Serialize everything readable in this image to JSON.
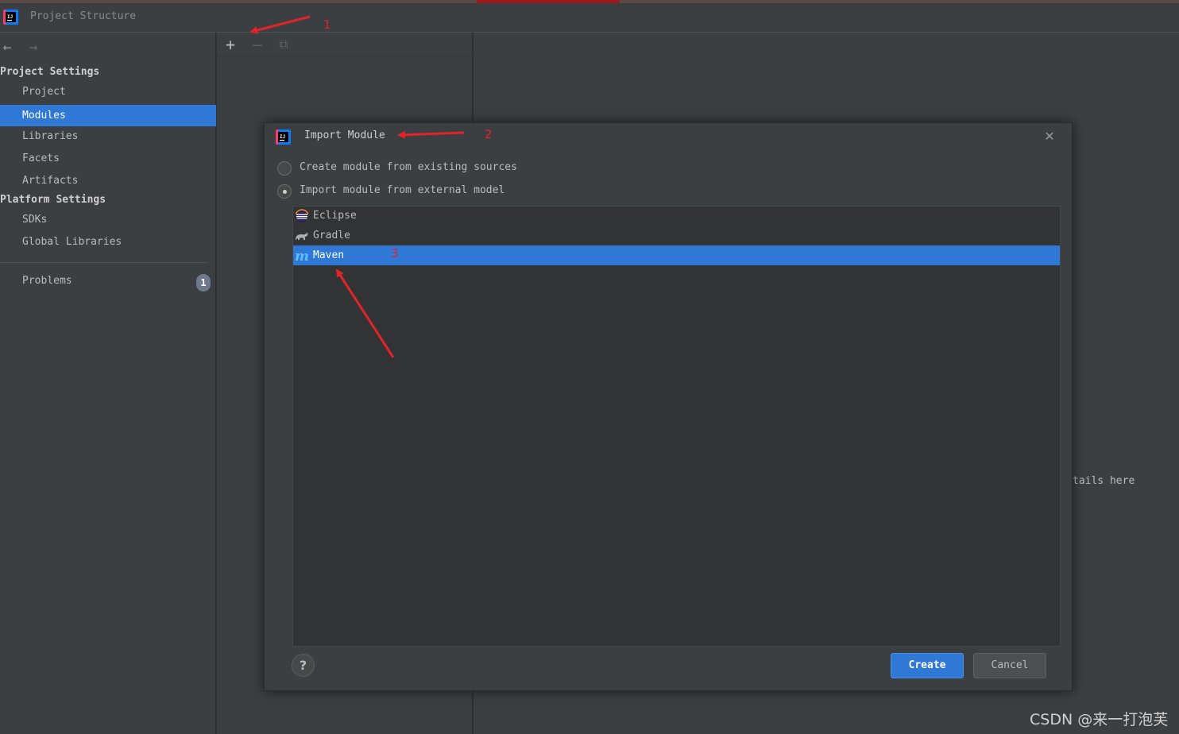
{
  "window": {
    "title": "Project Structure"
  },
  "sidebar": {
    "project_settings_header": "Project Settings",
    "project_items": [
      "Project",
      "Modules",
      "Libraries",
      "Facets",
      "Artifacts"
    ],
    "platform_settings_header": "Platform Settings",
    "platform_items": [
      "SDKs",
      "Global Libraries"
    ],
    "problems_label": "Problems",
    "problems_count": "1"
  },
  "right_panel": {
    "hint_text": "tails here"
  },
  "dialog": {
    "title": "Import Module",
    "options": [
      {
        "label": "Create module from existing sources",
        "checked": false
      },
      {
        "label": "Import module from external model",
        "checked": true
      }
    ],
    "models": [
      {
        "label": "Eclipse",
        "icon": "eclipse-icon"
      },
      {
        "label": "Gradle",
        "icon": "gradle-icon"
      },
      {
        "label": "Maven",
        "icon": "maven-icon",
        "selected": true
      }
    ],
    "help_label": "?",
    "create_label": "Create",
    "cancel_label": "Cancel"
  },
  "annotations": {
    "label_1": "1",
    "label_2": "2",
    "label_3": "3"
  },
  "watermark": "CSDN @来一打泡芙",
  "colors": {
    "selection": "#2f78d6",
    "annotation": "#e0242a",
    "panel": "#3c3f41"
  }
}
